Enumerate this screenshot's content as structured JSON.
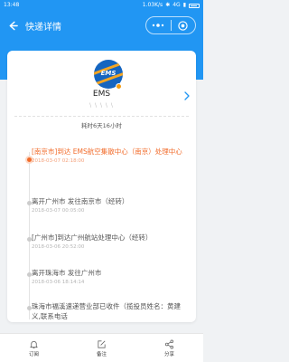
{
  "status_bar": {
    "time": "13:48",
    "network_speed": "1.03K/s",
    "signal": "4G"
  },
  "nav": {
    "title": "快递详情"
  },
  "header": {
    "logo_text": "EMS",
    "company": "EMS",
    "tracking_number": "\\ \\ \\ \\ \\",
    "elapsed": "耗时6天16小时"
  },
  "timeline": [
    {
      "text": "[南京市]到达 EMS航空集散中心（南京）处理中心",
      "time": "2018-03-07 02:18:00",
      "active": true
    },
    {
      "text": "离开广州市 发往南京市（经转）",
      "time": "2018-03-07 00:05:00",
      "active": false
    },
    {
      "text": "[广州市]到达广州航站处理中心（经转）",
      "time": "2018-03-06 20:52:00",
      "active": false
    },
    {
      "text": "离开珠海市 发往广州市",
      "time": "2018-03-06 18:14:14",
      "active": false
    },
    {
      "text": "珠海市福溪速递营业部已收件（揽投员姓名：黄建义,联系电话",
      "time": "",
      "active": false
    }
  ],
  "tabs": [
    {
      "label": "订阅",
      "icon": "bell-icon"
    },
    {
      "label": "备注",
      "icon": "edit-icon"
    },
    {
      "label": "分享",
      "icon": "share-icon"
    }
  ],
  "colors": {
    "primary": "#2196f3",
    "accent": "#f26b2a"
  }
}
